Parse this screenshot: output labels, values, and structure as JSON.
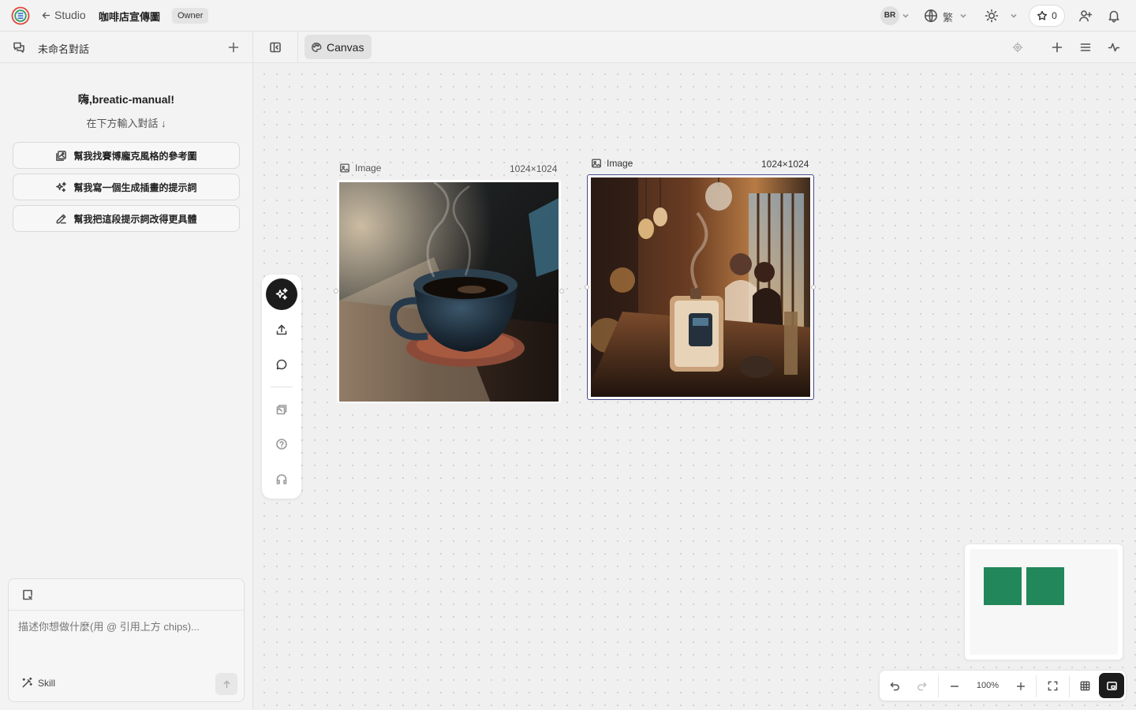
{
  "app": {
    "back_label": "Studio",
    "project_title": "咖啡店宣傳圖",
    "role_badge": "Owner",
    "user_initials": "BR",
    "language": "繁",
    "star_count": "0"
  },
  "chat": {
    "conversation_title": "未命名對話",
    "greeting": "嗨,breatic-manual!",
    "hint": "在下方輸入對話 ↓",
    "suggestions": [
      {
        "label": "幫我找賽博龐克風格的參考圖",
        "icon": "image-search-icon"
      },
      {
        "label": "幫我寫一個生成插畫的提示詞",
        "icon": "sparkles-icon"
      },
      {
        "label": "幫我把這段提示詞改得更具體",
        "icon": "pencil-icon"
      }
    ],
    "composer_placeholder": "描述你想做什麼(用 @ 引用上方 chips)...",
    "skill_label": "Skill"
  },
  "canvas": {
    "tab_label": "Canvas",
    "nodes": [
      {
        "type_label": "Image",
        "size_label": "1024×1024",
        "subject": "steaming coffee cup on saucer by sunny window"
      },
      {
        "type_label": "Image",
        "size_label": "1024×1024",
        "subject": "coffee shop counter with humidifier and pendant lights"
      }
    ],
    "zoom": "100%"
  },
  "colors": {
    "accent_dark": "#1c1c1c",
    "minimap_node": "#22875a",
    "selection": "#4b4a8f"
  }
}
